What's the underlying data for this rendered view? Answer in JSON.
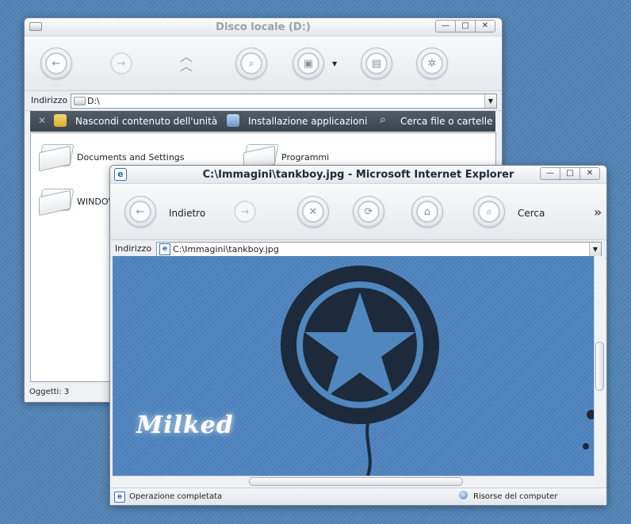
{
  "explorer": {
    "title": "Disco locale (D:)",
    "address_label": "Indirizzo",
    "address_value": "D:\\",
    "tasks": [
      {
        "label": "Nascondi contenuto dell'unità"
      },
      {
        "label": "Installazione applicazioni"
      },
      {
        "label": "Cerca file o cartelle"
      }
    ],
    "items": [
      {
        "label": "Documents and Settings"
      },
      {
        "label": "Programmi"
      },
      {
        "label": "WINDOWS"
      }
    ],
    "status": "Oggetti: 3"
  },
  "ie": {
    "title": "C:\\Immagini\\tankboy.jpg - Microsoft Internet Explorer",
    "back_label": "Indietro",
    "search_label": "Cerca",
    "more_label": "»",
    "address_label": "Indirizzo",
    "address_value": "C:\\Immagini\\tankboy.jpg",
    "image_text": "Milked",
    "status_left": "Operazione completata",
    "status_right": "Risorse del computer"
  },
  "icons": {
    "window_min": "—",
    "window_max": "□",
    "window_close": "✕"
  },
  "colors": {
    "desktop": "#5585b5",
    "task_bar": "#434b55",
    "image_bg": "#5087bf",
    "star_dark": "#1c2a3c"
  }
}
